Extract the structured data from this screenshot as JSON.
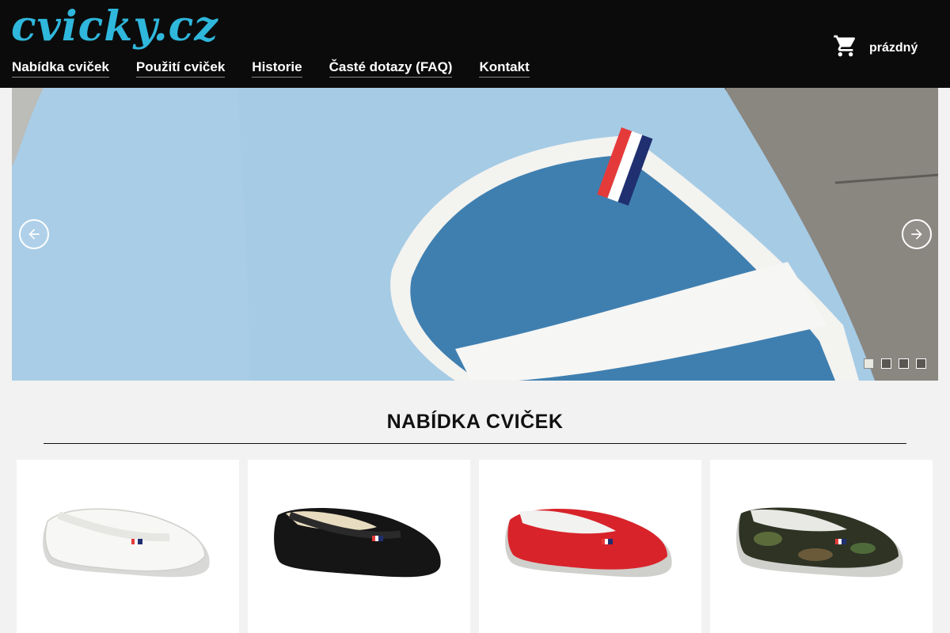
{
  "header": {
    "logo_text": "cvicky.cz",
    "nav": [
      {
        "label": "Nabídka cviček"
      },
      {
        "label": "Použití cviček"
      },
      {
        "label": "Historie"
      },
      {
        "label": "Časté dotazy (FAQ)"
      },
      {
        "label": "Kontakt"
      }
    ],
    "cart": {
      "icon": "shopping-cart-icon",
      "label": "prázdný"
    }
  },
  "slider": {
    "prev_icon": "arrow-left-icon",
    "next_icon": "arrow-right-icon",
    "slide_count": 4,
    "active_slide": 1
  },
  "section": {
    "title": "NABÍDKA CVIČEK"
  },
  "products": [
    {
      "color_name": "white",
      "color": "#f4f4f2"
    },
    {
      "color_name": "black",
      "color": "#1a1a1a"
    },
    {
      "color_name": "red",
      "color": "#d8232a"
    },
    {
      "color_name": "camouflage",
      "color": "#3e4a2c"
    }
  ],
  "colors": {
    "header_bg": "#0b0b0b",
    "logo": "#2fb7dc",
    "page_bg": "#f2f2f2"
  }
}
